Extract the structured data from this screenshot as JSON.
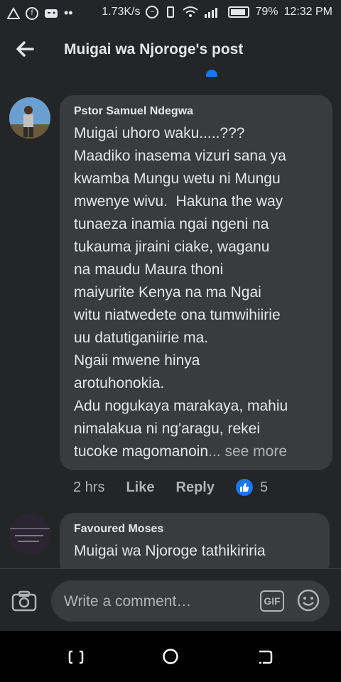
{
  "status_bar": {
    "network_speed": "1.73K/s",
    "battery": "79%",
    "time": "12:32 PM"
  },
  "header": {
    "title": "Muigai wa Njoroge's post"
  },
  "comments": [
    {
      "author": "Pstor Samuel Ndegwa",
      "text": "Muigai uhoro waku.....???\nMaadiko inasema vizuri sana ya\nkwamba Mungu wetu ni Mungu\nmwenye wivu.  Hakuna the way\ntunaeza inamia ngai ngeni na\ntukauma jiraini ciake, waganu\nna maudu Maura thoni\nmaiyurite Kenya na ma Ngai\nwitu niatwedete ona tumwihiirie\nuu datutiganiirie ma.\nNgaii mwene hinya\narotuhonokia.\nAdu nogukaya marakaya, mahiu\nnimalakua ni ng'aragu, rekei\ntucoke magomanoin",
      "see_more": "... see more",
      "time": "2 hrs",
      "like_label": "Like",
      "reply_label": "Reply",
      "reaction_count": "5"
    },
    {
      "author": "Favoured Moses",
      "text": "Muigai wa Njoroge tathikiriria"
    }
  ],
  "composer": {
    "placeholder": "Write a comment…",
    "gif_label": "GIF"
  },
  "colors": {
    "background": "#242526",
    "bubble": "#3a3b3c",
    "text": "#e4e6eb",
    "muted": "#b0b3b8",
    "accent": "#1877f2"
  }
}
